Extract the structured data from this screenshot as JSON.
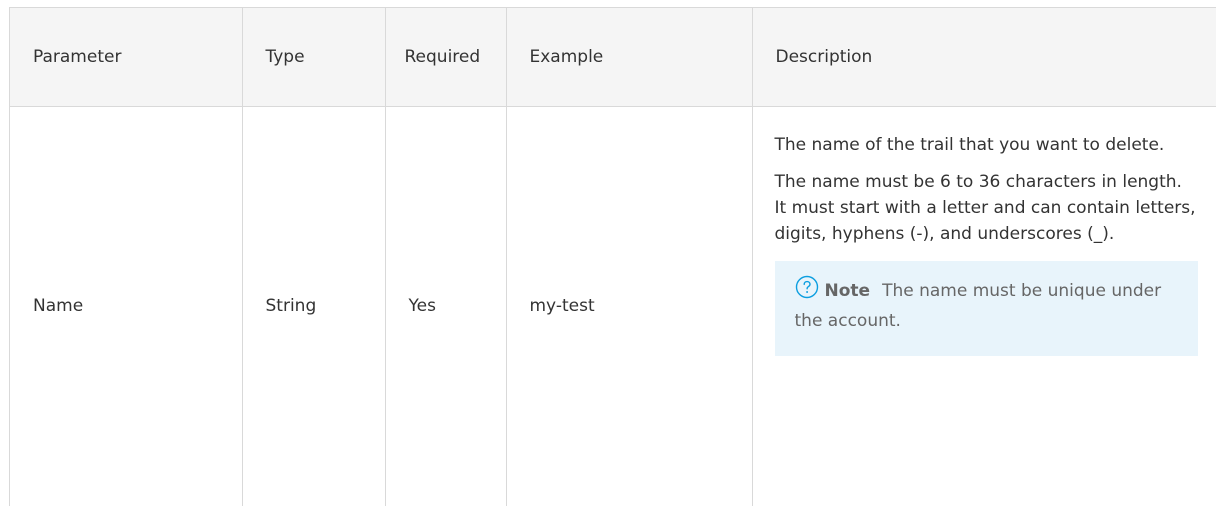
{
  "table": {
    "headers": {
      "parameter": "Parameter",
      "type": "Type",
      "required": "Required",
      "example": "Example",
      "description": "Description"
    },
    "rows": [
      {
        "parameter": "Name",
        "type": "String",
        "required": "Yes",
        "example": "my-test",
        "description": {
          "p1": "The name of the trail that you want to delete.",
          "p2": "The name must be 6 to 36 characters in length. It must start with a letter and can contain letters, digits, hyphens (-), and underscores (_).",
          "note": {
            "icon": "question-circle-icon",
            "label": "Note",
            "text": "The name must be unique under the account."
          }
        }
      }
    ]
  },
  "colors": {
    "header_bg": "#f5f5f5",
    "border": "#d9d9d9",
    "note_bg": "#e8f4fb",
    "note_icon": "#0b9ee0"
  }
}
